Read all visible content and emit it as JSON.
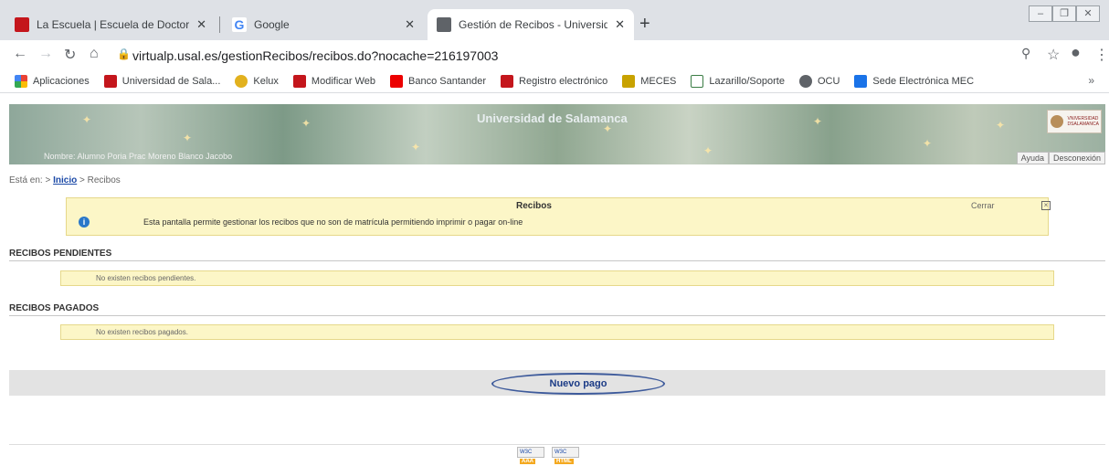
{
  "browser": {
    "tabs": [
      {
        "title": "La Escuela | Escuela de Doctoraci",
        "icon": "usal-icon"
      },
      {
        "title": "Google",
        "icon": "google-icon"
      },
      {
        "title": "Gestión de Recibos - Universidad",
        "icon": "globe-icon",
        "active": true
      }
    ],
    "url": "virtualp.usal.es/gestionRecibos/recibos.do?nocache=216197003",
    "bookmarks": [
      {
        "label": "Aplicaciones",
        "icon": "apps-icon",
        "color": "#d93025"
      },
      {
        "label": "Universidad de Sala...",
        "icon": "usal-icon",
        "color": "#c4161c"
      },
      {
        "label": "Kelux",
        "icon": "kelux-icon",
        "color": "#e2b11e"
      },
      {
        "label": "Modificar Web",
        "icon": "usal-icon",
        "color": "#c4161c"
      },
      {
        "label": "Banco Santander",
        "icon": "santander-icon",
        "color": "#ec0000"
      },
      {
        "label": "Registro electrónico",
        "icon": "usal-icon",
        "color": "#c4161c"
      },
      {
        "label": "MECES",
        "icon": "meces-icon",
        "color": "#c8a200"
      },
      {
        "label": "Lazarillo/Soporte",
        "icon": "lazarillo-icon",
        "color": "#3a7d44"
      },
      {
        "label": "OCU",
        "icon": "globe-icon",
        "color": "#5f6368"
      },
      {
        "label": "Sede Electrónica MEC",
        "icon": "sede-icon",
        "color": "#1a73e8"
      }
    ],
    "more": "»"
  },
  "banner": {
    "title": "Universidad de Salamanca",
    "user": "Nombre: Alumno Poria Prac Moreno Blanco Jacobo",
    "logo_text": "VNIVERSIDAD DSALAMANCA",
    "help": "Ayuda",
    "logout": "Desconexión"
  },
  "breadcrumb": {
    "prefix": "Está en:",
    "sep1": ">",
    "home": "Inicio",
    "sep2": ">",
    "current": "Recibos"
  },
  "info": {
    "title": "Recibos",
    "close": "Cerrar",
    "close_x": "×",
    "icon": "i",
    "text": "Esta pantalla permite gestionar los recibos que no son de matrícula permitiendo imprimir o pagar on-line"
  },
  "pendientes": {
    "title": "RECIBOS PENDIENTES",
    "empty": "No existen recibos pendientes."
  },
  "pagados": {
    "title": "RECIBOS PAGADOS",
    "empty": "No existen recibos pagados."
  },
  "actions": {
    "nuevo_pago": "Nuevo pago"
  },
  "footer": {
    "badge1": "W3C",
    "badge1_level": "AAA",
    "badge2": "W3C",
    "badge2_level": "HTML"
  }
}
